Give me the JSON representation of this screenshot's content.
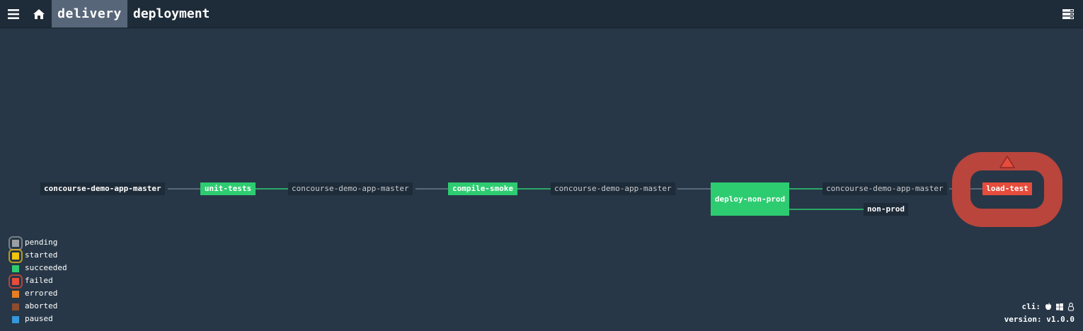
{
  "topbar": {
    "group_label": "delivery",
    "pipeline_label": "deployment"
  },
  "graph": {
    "resources": {
      "r1": "concourse-demo-app-master",
      "r2": "concourse-demo-app-master",
      "r3": "concourse-demo-app-master",
      "r4": "concourse-demo-app-master",
      "r5": "non-prod"
    },
    "jobs": {
      "unit_tests": "unit-tests",
      "compile_smoke": "compile-smoke",
      "deploy_non_prod": "deploy-non-prod",
      "load_test": "load-test"
    }
  },
  "legend": {
    "items": [
      {
        "label": "pending",
        "color": "#9b9fa3"
      },
      {
        "label": "started",
        "color": "#f1c40f"
      },
      {
        "label": "succeeded",
        "color": "#2ecc71"
      },
      {
        "label": "failed",
        "color": "#e74c3c"
      },
      {
        "label": "errored",
        "color": "#e67e22"
      },
      {
        "label": "aborted",
        "color": "#8f4b2d"
      },
      {
        "label": "paused",
        "color": "#3498db"
      }
    ]
  },
  "footer": {
    "cli_label": "cli:",
    "cli_icons": [
      "apple-icon",
      "windows-icon",
      "linux-icon"
    ],
    "version_label": "version:",
    "version_value": "v1.0.0"
  },
  "colors": {
    "background": "#273747",
    "topbar": "#1e2b38",
    "active_group": "#586679",
    "succeeded": "#2ecc71",
    "failed": "#e74c3c"
  }
}
